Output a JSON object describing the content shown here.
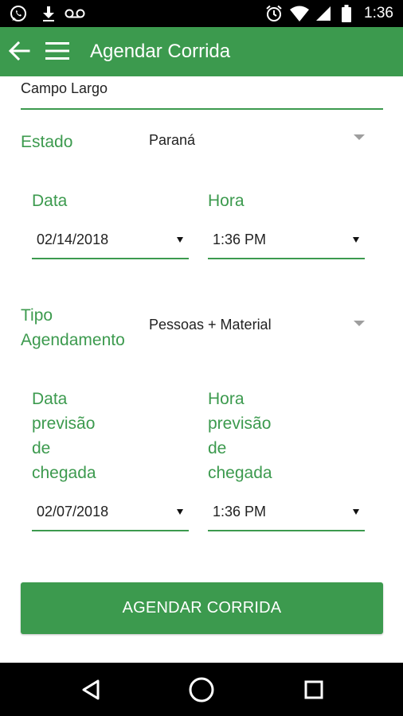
{
  "status_bar": {
    "time": "1:36",
    "left_icons": [
      "whatsapp-icon",
      "download-icon",
      "voicemail-icon"
    ],
    "right_icons": [
      "alarm-icon",
      "wifi-icon",
      "signal-icon",
      "battery-icon"
    ]
  },
  "app_bar": {
    "title": "Agendar Corrida",
    "back_icon": "arrow-back-icon",
    "menu_icon": "hamburger-menu-icon",
    "color": "#3c9a4e"
  },
  "form": {
    "city": "Campo Largo",
    "estado_label": "Estado",
    "estado_value": "Paraná",
    "data_label": "Data",
    "data_value": "02/14/2018",
    "hora_label": "Hora",
    "hora_value": "1:36 PM",
    "tipo_label_line1": "Tipo",
    "tipo_label_line2": "Agendamento",
    "tipo_value": "Pessoas + Material",
    "data_prev_label": [
      "Data",
      "previsão",
      "de",
      "chegada"
    ],
    "data_prev_value": "02/07/2018",
    "hora_prev_label": [
      "Hora",
      "previsão",
      "de",
      "chegada"
    ],
    "hora_prev_value": "1:36 PM",
    "submit_label": "AGENDAR CORRIDA"
  },
  "nav_bar": {
    "icons": [
      "back-triangle-icon",
      "home-circle-icon",
      "recents-square-icon"
    ]
  }
}
